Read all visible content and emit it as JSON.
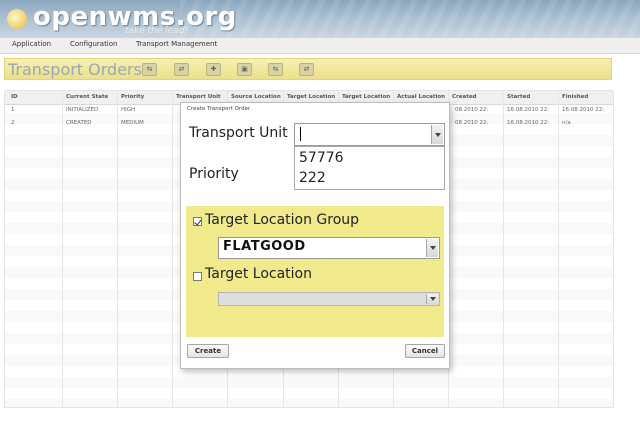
{
  "app": {
    "logo_text": "openwms.org",
    "tagline": "take the lead!"
  },
  "menu": [
    {
      "label": "Application"
    },
    {
      "label": "Configuration"
    },
    {
      "label": "Transport Management"
    }
  ],
  "page": {
    "title": "Transport Orders"
  },
  "table": {
    "columns": [
      "ID",
      "Current State",
      "Priority",
      "Transport Unit",
      "Source Location",
      "Target Location",
      "Target Location",
      "Actual Location",
      "Created",
      "Started",
      "Finished"
    ],
    "rows": [
      {
        "id": "1",
        "state": "INITIALIZED",
        "priority": "HIGH",
        "created": "08.2010 22:",
        "started": "16.08.2010 22:",
        "finished": "16.08.2010 22:"
      },
      {
        "id": "2",
        "state": "CREATED",
        "priority": "MEDIUM",
        "created": "08.2010 22:",
        "started": "16.08.2010 22:",
        "finished": "n/a"
      }
    ]
  },
  "dialog": {
    "title": "Create Transport Order",
    "transport_unit_label": "Transport Unit",
    "priority_label": "Priority",
    "transport_unit_options": [
      "57776",
      "222"
    ],
    "target_group_label": "Target Location Group",
    "target_group_checked": true,
    "target_group_value": "FLATGOOD",
    "target_location_label": "Target Location",
    "target_location_checked": false,
    "create_label": "Create",
    "cancel_label": "Cancel"
  },
  "colors": {
    "accent_yellow": "#f1ea8c",
    "title_text": "#9aa7b3",
    "header_blue": "#a9bfd1"
  },
  "icons": [
    "toolbar-action-icon"
  ]
}
